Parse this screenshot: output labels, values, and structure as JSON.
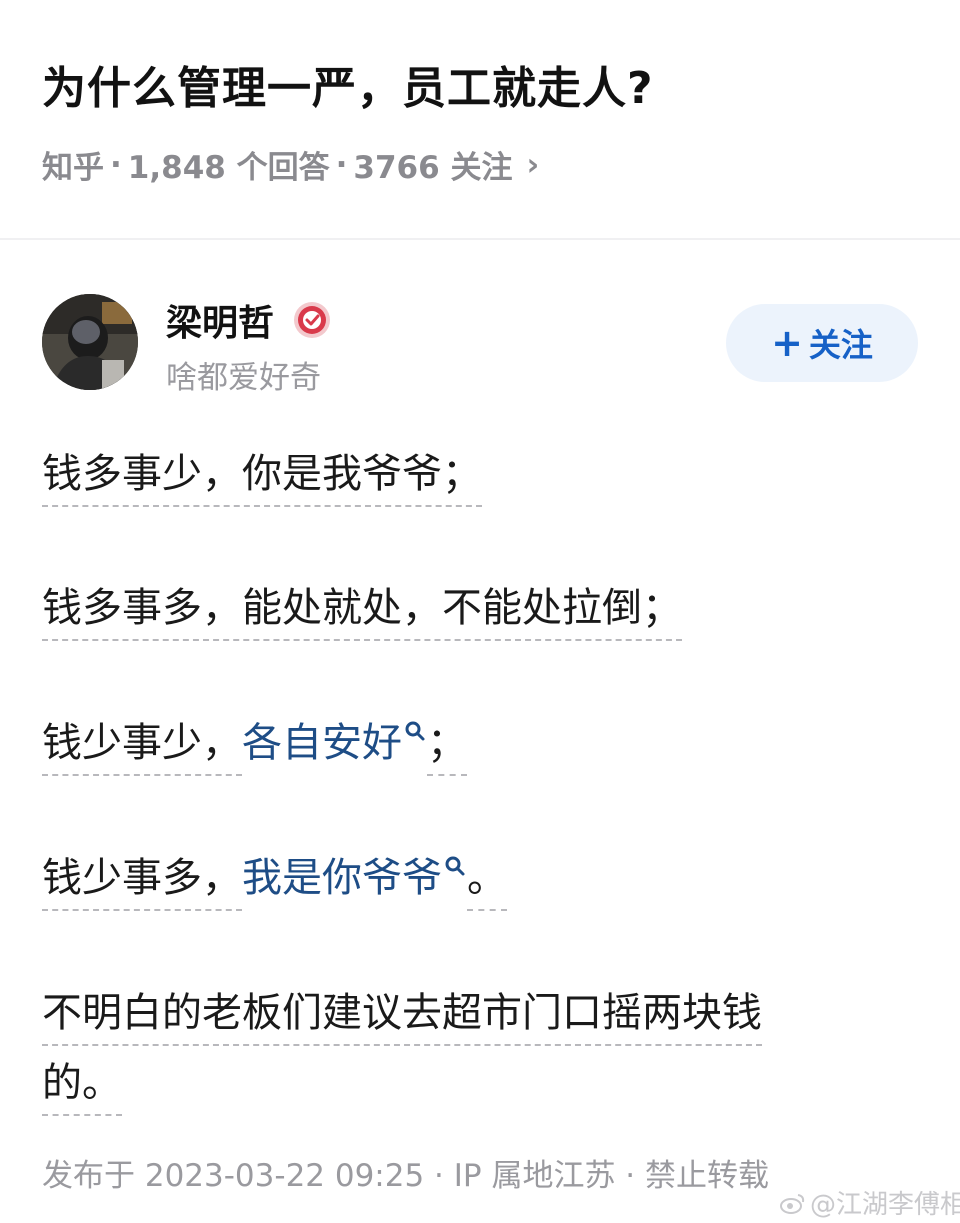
{
  "question": {
    "title": "为什么管理一严，员工就走人?",
    "meta": {
      "source": "知乎",
      "separator": "·",
      "answers": "1,848 个回答",
      "followers": "3766 关注",
      "chevron": "›"
    }
  },
  "author": {
    "name": "梁明哲",
    "bio": "啥都爱好奇",
    "follow_label": "关注",
    "follow_plus": "+"
  },
  "answer": {
    "p1": "钱多事少，你是我爷爷；",
    "p2": "钱多事多，能处就处，不能处拉倒；",
    "p3_prefix": "钱少事少，",
    "p3_keyword": "各自安好",
    "p3_suffix": "；",
    "p4_prefix": "钱少事多，",
    "p4_keyword": "我是你爷爷",
    "p4_suffix": "。",
    "p5_line1": "不明白的老板们建议去超市门口摇两块钱",
    "p5_line2": "的。"
  },
  "footer": {
    "info": "发布于 2023-03-22 09:25 · IP 属地江苏 · 禁止转载"
  },
  "watermark": {
    "text": "@江湖李傅相"
  },
  "colors": {
    "keyword": "#1e4d86",
    "follow_text": "#1661c7",
    "follow_bg": "#ecf3fc",
    "meta_gray": "#8a8a8f",
    "badge_red": "#d93a4b"
  },
  "icons": [
    "verified-badge-icon",
    "search-icon",
    "chevron-right-icon",
    "plus-icon",
    "weibo-icon"
  ]
}
